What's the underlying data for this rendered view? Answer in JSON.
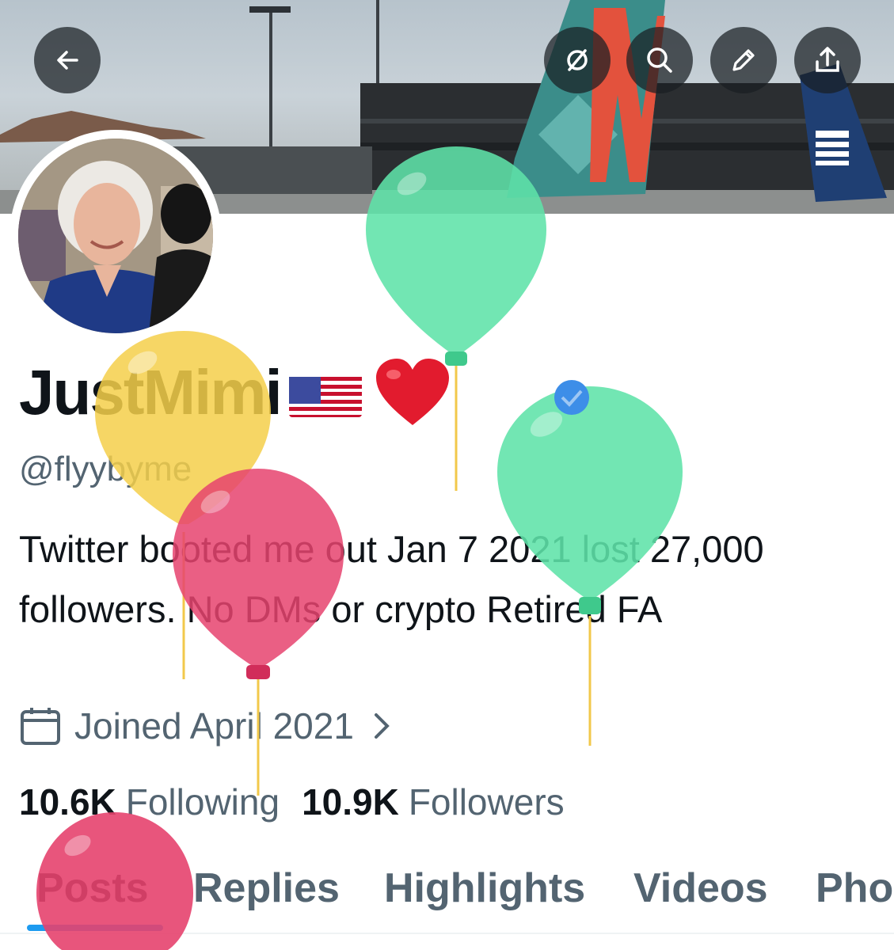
{
  "profile": {
    "display_name": "JustMimi",
    "handle": "@flyybyme",
    "bio": "Twitter booted me out Jan 7 2021 lost 27,000 followers. No DMs or crypto Retired FA",
    "joined": "Joined April 2021",
    "following_count": "10.6K",
    "following_label": "Following",
    "followers_count": "10.9K",
    "followers_label": "Followers"
  },
  "header_buttons": [
    "back-arrow-icon",
    "hide-icon",
    "search-icon",
    "edit-icon",
    "share-icon"
  ],
  "tabs": [
    {
      "label": "Posts",
      "active": true
    },
    {
      "label": "Replies",
      "active": false
    },
    {
      "label": "Highlights",
      "active": false
    },
    {
      "label": "Videos",
      "active": false
    },
    {
      "label": "Pho",
      "active": false
    }
  ],
  "colors": {
    "accent": "#1d9bf0",
    "text_primary": "#0f1419",
    "text_secondary": "#536471",
    "balloon_green": "#5fe3a8",
    "balloon_yellow": "#f5cf4a",
    "balloon_pink": "#e6436e"
  }
}
